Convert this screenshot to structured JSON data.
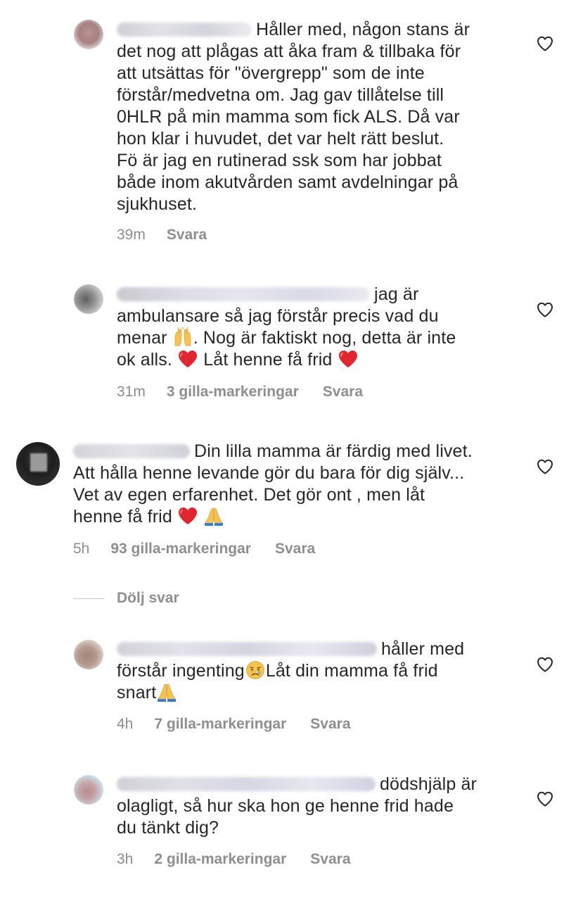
{
  "comments": [
    {
      "lines": [
        "Håller med, någon stans är",
        "det nog att plågas att åka fram & tillbaka för",
        "att utsättas för \"övergrepp\" som de inte",
        "förstår/medvetna om. Jag gav tillåtelse till",
        "0HLR på min mamma som fick ALS. Då var",
        "hon klar i huvudet, det var helt rätt beslut.",
        "Fö är jag en rutinerad ssk som har jobbat",
        "både inom akutvården samt avdelningar på",
        "sjukhuset."
      ],
      "time": "39m",
      "likes": "",
      "reply_label": "Svara"
    },
    {
      "lines": [
        "jag är",
        "ambulansare så jag förstår precis vad du",
        "menar",
        ". Nog är faktiskt nog, detta är inte",
        "ok alls.",
        "Låt henne få frid"
      ],
      "time": "31m",
      "likes": "3 gilla-markeringar",
      "reply_label": "Svara"
    },
    {
      "lines": [
        "Din lilla mamma är färdig med livet.",
        "Att hålla henne levande gör du bara för dig själv...",
        "Vet av egen erfarenhet. Det gör ont , men låt",
        "henne få frid"
      ],
      "time": "5h",
      "likes": "93 gilla-markeringar",
      "reply_label": "Svara"
    },
    {
      "lines": [
        "håller med",
        "förstår ingenting",
        "Låt din mamma få frid",
        "snart"
      ],
      "time": "4h",
      "likes": "7 gilla-markeringar",
      "reply_label": "Svara"
    },
    {
      "lines": [
        "dödshjälp är",
        "olagligt, så hur ska hon ge henne frid hade",
        "du tänkt dig?"
      ],
      "time": "3h",
      "likes": "2 gilla-markeringar",
      "reply_label": "Svara"
    }
  ],
  "hide_replies_label": "Dölj svar",
  "colors": {
    "text": "#262626",
    "meta": "#8e8e8e",
    "heart_stroke": "#262626",
    "red_heart": "#e2262f"
  },
  "icons": {
    "like": "heart-outline-icon",
    "emoji_hands": "raising-hands-emoji",
    "emoji_heart": "red-heart-emoji",
    "emoji_pray": "folded-hands-emoji",
    "emoji_cry": "crying-face-emoji"
  }
}
